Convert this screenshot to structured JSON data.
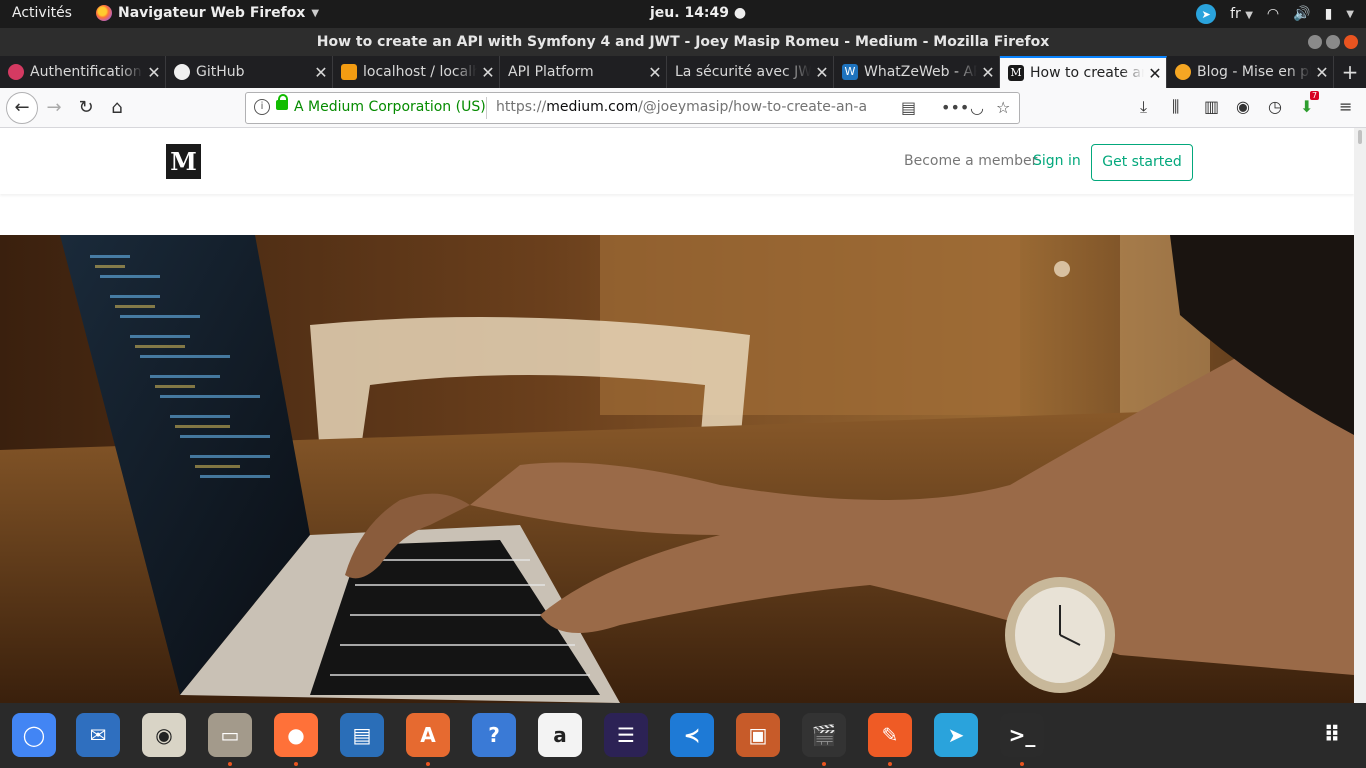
{
  "topbar": {
    "activities": "Activités",
    "app_menu": "Navigateur Web Firefox",
    "clock": "jeu. 14:49 ●",
    "lang": "fr"
  },
  "window": {
    "title": "How to create an API with Symfony 4 and JWT - Joey Masip Romeu - Medium - Mozilla Firefox"
  },
  "tabs": [
    {
      "title": "Authentification",
      "icon": "authentification-tab-icon",
      "color": "#d43a62"
    },
    {
      "title": "GitHub",
      "icon": "github-icon",
      "color": "#f0f0f0"
    },
    {
      "title": "localhost / localhost",
      "icon": "phpmyadmin-icon",
      "color": "#f39c12"
    },
    {
      "title": "API Platform",
      "icon": "blank-page-icon",
      "color": "#1f1f22"
    },
    {
      "title": "La sécurité avec JWT",
      "icon": "blank-page-icon",
      "color": "#1f1f22"
    },
    {
      "title": "WhatZeWeb - API",
      "icon": "whatzeweb-icon",
      "color": "#1e73be"
    },
    {
      "title": "How to create an API",
      "icon": "medium-icon",
      "color": "#1a1a1a",
      "active": true
    },
    {
      "title": "Blog - Mise en place",
      "icon": "blog-icon",
      "color": "#f5a623"
    }
  ],
  "urlbar": {
    "org": "A Medium Corporation (US)",
    "url_prefix": "https://",
    "url_domain": "medium.com",
    "url_path": "/@joeymasip/how-to-create-an-api",
    "downloads_badge": "7"
  },
  "medium": {
    "logo": "M",
    "become_member": "Become a member",
    "sign_in": "Sign in",
    "get_started": "Get started",
    "accent": "#03a87c"
  },
  "dock": [
    {
      "name": "chromium-icon",
      "color": "#4285f4",
      "glyph": "◯"
    },
    {
      "name": "thunderbird-icon",
      "color": "#2f6fbf",
      "glyph": "✉"
    },
    {
      "name": "rhythmbox-icon",
      "color": "#d9d4c6",
      "glyph": "◉"
    },
    {
      "name": "files-icon",
      "color": "#a39a8b",
      "glyph": "▭"
    },
    {
      "name": "firefox-icon",
      "color": "#ff7139",
      "glyph": "●"
    },
    {
      "name": "libreoffice-writer-icon",
      "color": "#2a6eb8",
      "glyph": "▤"
    },
    {
      "name": "ubuntu-software-icon",
      "color": "#e66a30",
      "glyph": "A"
    },
    {
      "name": "help-icon",
      "color": "#3a7ad6",
      "glyph": "?"
    },
    {
      "name": "amazon-icon",
      "color": "#f3f3f3",
      "glyph": "a"
    },
    {
      "name": "eclipse-icon",
      "color": "#2c2255",
      "glyph": "☰"
    },
    {
      "name": "vscode-icon",
      "color": "#1e7ad6",
      "glyph": "≺"
    },
    {
      "name": "libreoffice-impress-icon",
      "color": "#c75b29",
      "glyph": "▣"
    },
    {
      "name": "openshot-icon",
      "color": "#333333",
      "glyph": "🎬"
    },
    {
      "name": "postman-icon",
      "color": "#ef5b25",
      "glyph": "✎"
    },
    {
      "name": "telegram-icon",
      "color": "#2aa3dc",
      "glyph": "➤"
    },
    {
      "name": "terminal-icon",
      "color": "#2b2b2b",
      "glyph": ">_"
    }
  ]
}
